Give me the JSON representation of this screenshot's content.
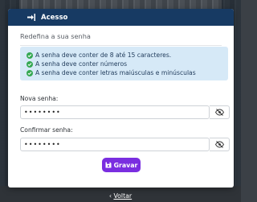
{
  "modal": {
    "title": "Acesso",
    "subtitle": "Redefina a sua senha"
  },
  "rules": [
    "A senha deve conter de 8 até 15 caracteres.",
    "A senha deve conter números",
    "A senha deve conter letras maiúsculas e minúsculas"
  ],
  "fields": {
    "new_password": {
      "label": "Nova senha:",
      "value": "••••••••"
    },
    "confirm_password": {
      "label": "Confirmar senha:",
      "value": "••••••••"
    }
  },
  "buttons": {
    "save": "Gravar",
    "back_arrow": "‹",
    "back": "Voltar"
  },
  "colors": {
    "header": "#173a63",
    "accent_button": "#7a2ee0",
    "info_alert": "#d6e9f7",
    "check": "#35a852"
  }
}
